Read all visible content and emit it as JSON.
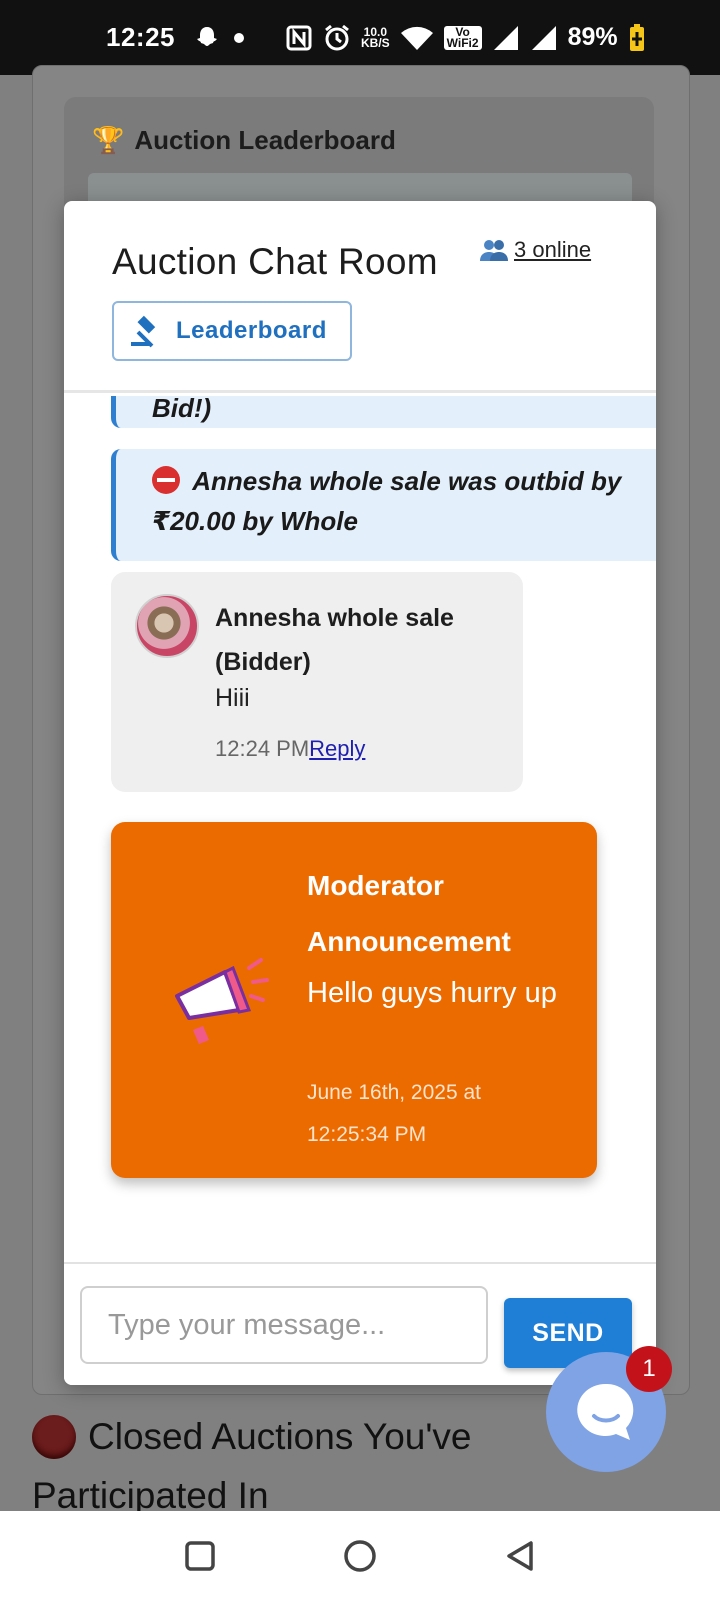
{
  "status_bar": {
    "time": "12:25",
    "net_speed_top": "10.0",
    "net_speed_bottom": "KB/S",
    "vowifi_top": "Vo",
    "vowifi_bottom": "WiFi2",
    "battery": "89%"
  },
  "background": {
    "leaderboard_title": "Auction Leaderboard",
    "closed_auctions_line1": "Closed Auctions You've",
    "closed_auctions_line2": "Participated In"
  },
  "modal": {
    "title": "Auction Chat Room",
    "online_count": "3 online",
    "leaderboard_button": "Leaderboard"
  },
  "messages": {
    "system_top_partial": "Bid!)",
    "system_outbid": "Annesha whole sale was outbid by ₹20.00 by Whole",
    "chat": {
      "sender": "Annesha whole sale (Bidder)",
      "text": "Hiii",
      "time": "12:24 PM",
      "reply_label": "Reply"
    },
    "announcement": {
      "title": "Moderator Announcement",
      "text": "Hello guys hurry up",
      "date": "June 16th, 2025 at 12:25:34 PM"
    }
  },
  "input": {
    "placeholder": "Type your message...",
    "send_label": "SEND"
  },
  "chat_fab": {
    "badge": "1"
  },
  "colors": {
    "accent": "#1f7fd7",
    "announcement": "#ec6b00",
    "badge": "#c4121b"
  }
}
